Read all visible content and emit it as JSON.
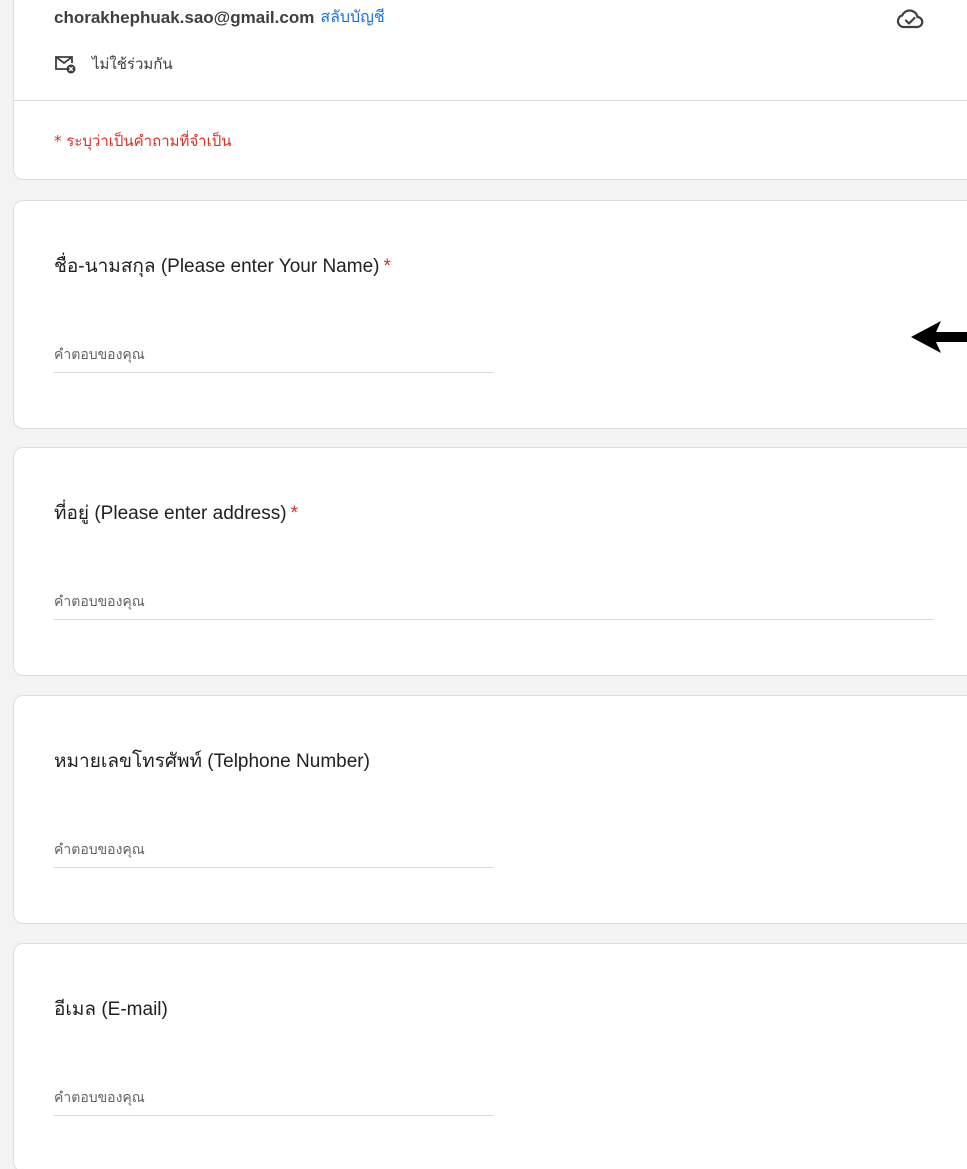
{
  "header": {
    "account_email": "chorakhephuak.sao@gmail.com",
    "switch_account": "สลับบัญชี",
    "not_shared": "ไม่ใช้ร่วมกัน",
    "required_note": "* ระบุว่าเป็นคำถามที่จำเป็น",
    "cloud_icon": "cloud-saved-icon",
    "mail_icon": "mail-not-shared-icon"
  },
  "questions": [
    {
      "title": "ชื่อ-นามสกุล (Please enter Your Name)",
      "required_mark": "*",
      "placeholder": "คำตอบของคุณ",
      "value": ""
    },
    {
      "title": "ที่อยู่ (Please enter address)",
      "required_mark": "*",
      "placeholder": "คำตอบของคุณ",
      "value": ""
    },
    {
      "title": "หมายเลขโทรศัพท์ (Telphone Number)",
      "placeholder": "คำตอบของคุณ",
      "value": ""
    },
    {
      "title": "อีเมล (E-mail)",
      "placeholder": "คำตอบของคุณ",
      "value": ""
    }
  ],
  "colors": {
    "accent_link": "#1a73e8",
    "required_red": "#d93025",
    "card_border": "#dadce0",
    "background": "#f3f3f3"
  }
}
